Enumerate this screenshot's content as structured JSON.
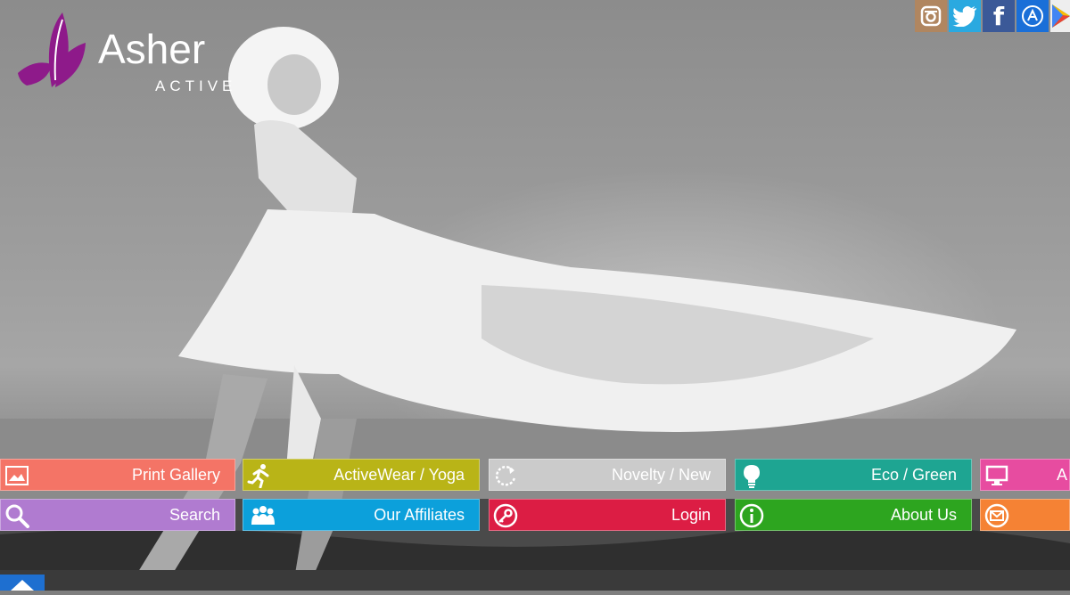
{
  "brand": {
    "name": "Asher",
    "tagline": "ACTIVE",
    "color": "#8e1a8a"
  },
  "social": [
    {
      "name": "instagram-icon",
      "color": "#b08660"
    },
    {
      "name": "twitter-icon",
      "color": "#2aa9e0"
    },
    {
      "name": "facebook-icon",
      "color": "#3b5998"
    },
    {
      "name": "app-store-icon",
      "color": "#1a6fd8"
    },
    {
      "name": "google-play-icon",
      "color": "#eeeeee"
    }
  ],
  "tiles": {
    "print_gallery": {
      "label": "Print Gallery",
      "color": "#f47466",
      "icon": "gallery-icon"
    },
    "activewear": {
      "label": "ActiveWear / Yoga",
      "color": "#b9b417",
      "icon": "runner-icon"
    },
    "novelty": {
      "label": "Novelty / New",
      "color": "#cbcbcb",
      "icon": "refresh-icon"
    },
    "eco": {
      "label": "Eco / Green",
      "color": "#1ea592",
      "icon": "lightbulb-icon"
    },
    "partial_top": {
      "label": "A",
      "color": "#e74ca0",
      "icon": "monitor-icon"
    },
    "search": {
      "label": "Search",
      "color": "#b07bd0",
      "icon": "search-icon"
    },
    "affiliates": {
      "label": "Our Affiliates",
      "color": "#0ca0db",
      "icon": "people-icon"
    },
    "login": {
      "label": "Login",
      "color": "#dc1d44",
      "icon": "key-icon"
    },
    "about": {
      "label": "About Us",
      "color": "#2da51f",
      "icon": "info-icon"
    },
    "partial_bottom": {
      "label": "",
      "color": "#f58234",
      "icon": "mail-icon"
    }
  }
}
